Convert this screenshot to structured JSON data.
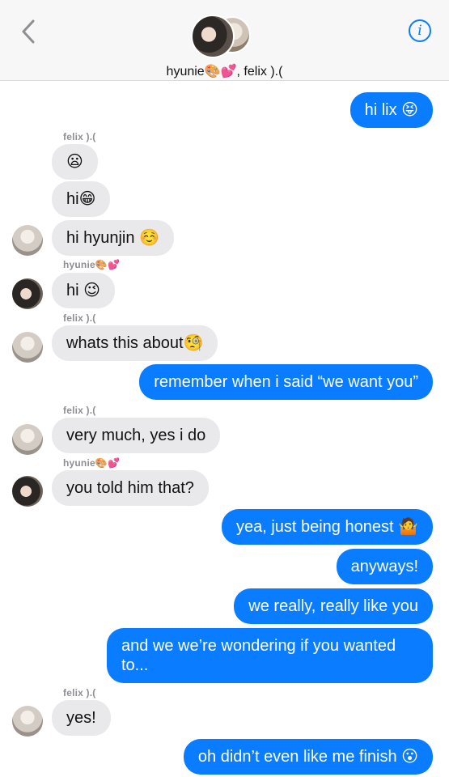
{
  "header": {
    "group_name": "hyunie🎨💕, felix ).(",
    "back_icon": "chevron-left-icon",
    "info_icon": "info-icon"
  },
  "colors": {
    "outgoing": "#0a7cff",
    "incoming": "#e9e9eb",
    "accent": "#0a7cff"
  },
  "messages": [
    {
      "dir": "out",
      "text": "hi lix 😝"
    },
    {
      "dir": "in",
      "sender": "felix ).(",
      "text": "😦"
    },
    {
      "dir": "in",
      "text": "hi😁"
    },
    {
      "dir": "in",
      "text": "hi hyunjin ☺️"
    },
    {
      "dir": "in",
      "sender": "hyunie🎨💕",
      "text": "hi 😉"
    },
    {
      "dir": "in",
      "sender": "felix ).(",
      "text": "whats this about🧐"
    },
    {
      "dir": "out",
      "text": "remember when i said “we want you”"
    },
    {
      "dir": "in",
      "sender": "felix ).(",
      "text": "very much, yes i do"
    },
    {
      "dir": "in",
      "sender": "hyunie🎨💕",
      "text": "you told him that?"
    },
    {
      "dir": "out",
      "text": "yea, just being honest 🤷"
    },
    {
      "dir": "out",
      "text": "anyways!"
    },
    {
      "dir": "out",
      "text": "we really, really like you"
    },
    {
      "dir": "out",
      "text": "and we we’re wondering if you wanted to..."
    },
    {
      "dir": "in",
      "sender": "felix ).(",
      "text": "yes!"
    },
    {
      "dir": "out",
      "text": "oh didn’t even like me finish 😮"
    }
  ]
}
